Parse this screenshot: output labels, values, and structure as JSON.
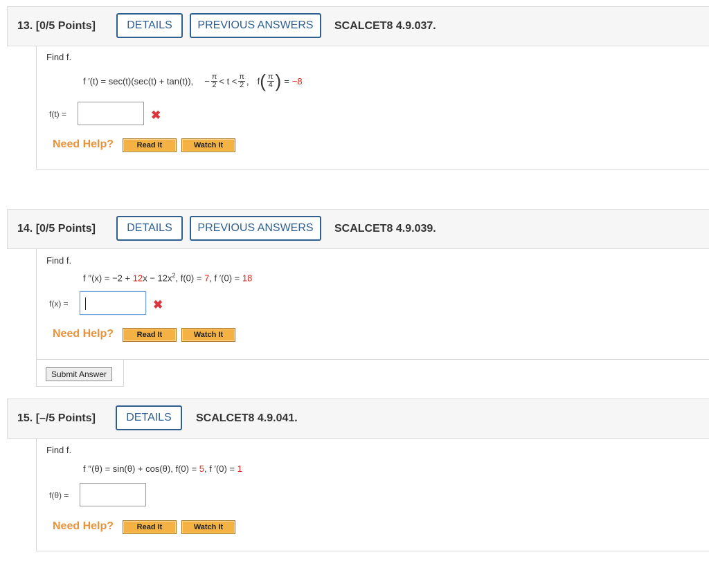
{
  "q13": {
    "number": "13.",
    "points": "[0/5 Points]",
    "details": "DETAILS",
    "previous": "PREVIOUS ANSWERS",
    "code": "SCALCET8 4.9.037.",
    "find": "Find f.",
    "eq_main": "f ′(t) = sec(t)(sec(t) + tan(t)),",
    "eq_minus": "−",
    "pi": "π",
    "two": "2",
    "lt_t_lt": "< t <",
    "comma": ",",
    "f": "f",
    "four": "4",
    "eq_equals": "=",
    "eq_value": "−8",
    "answer_label": "f(t) =",
    "answer_value": "",
    "x": "✖",
    "need_help": "Need Help?",
    "read_it": "Read It",
    "watch_it": "Watch It"
  },
  "q14": {
    "number": "14.",
    "points": "[0/5 Points]",
    "details": "DETAILS",
    "previous": "PREVIOUS ANSWERS",
    "code": "SCALCET8 4.9.039.",
    "find": "Find f.",
    "eq_a": "f ′′(x) = −2 +",
    "eq_b": "12",
    "eq_c": "x − 12x",
    "eq_sup": "2",
    "eq_d": ",   f(0) =",
    "eq_e": "7",
    "eq_f": ",   f ′(0) =",
    "eq_g": "18",
    "answer_label": "f(x) =",
    "answer_value": "",
    "x": "✖",
    "need_help": "Need Help?",
    "read_it": "Read It",
    "watch_it": "Watch It",
    "submit": "Submit Answer"
  },
  "q15": {
    "number": "15.",
    "points": "[–/5 Points]",
    "details": "DETAILS",
    "code": "SCALCET8 4.9.041.",
    "find": "Find f.",
    "eq_a": "f ′′(θ) = sin(θ) + cos(θ),   f(0) =",
    "eq_b": "5",
    "eq_c": ",   f ′(0) =",
    "eq_d": "1",
    "answer_label": "f(θ) =",
    "answer_value": "",
    "need_help": "Need Help?",
    "read_it": "Read It",
    "watch_it": "Watch It"
  }
}
